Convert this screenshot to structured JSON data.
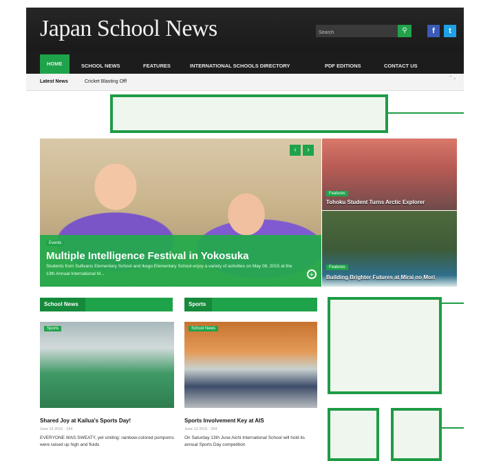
{
  "site": {
    "title": "Japan School News"
  },
  "search": {
    "placeholder": "Search",
    "button_icon": "⚲"
  },
  "social": {
    "facebook": "f",
    "twitter": "t"
  },
  "nav": {
    "items": [
      "HOME",
      "SCHOOL NEWS",
      "FEATURES",
      "INTERNATIONAL SCHOOLS DIRECTORY",
      "PDF EDITIONS",
      "CONTACT US"
    ]
  },
  "ticker": {
    "label": "Latest News",
    "text": "Cricket Blasting Off!",
    "arrows": "⌃⌄"
  },
  "hero": {
    "badge": "Events",
    "title": "Multiple Intelligence Festival in Yokosuka",
    "subtitle": "Students from Sullivans Elementary School and Ikego Elementary School enjoy a variety of activities on May 08, 2015 at the 13th Annual International M...",
    "prev": "‹",
    "next": "›",
    "more": "+"
  },
  "side_stories": [
    {
      "badge": "Features",
      "title": "Tohoku Student Turns Arctic Explorer"
    },
    {
      "badge": "Features",
      "title": "Building Brighter Futures at Mirai no Mori"
    }
  ],
  "sections": [
    {
      "heading": "School News",
      "photo_badge": "Sports",
      "headline": "Shared Joy at Kailua's Sports Day!",
      "meta": "June 14 2015 · 194",
      "excerpt": "EVERYONE WAS SWEATY, yet smiling: rainbow-colored pompoms were raised up high and fluids"
    },
    {
      "heading": "Sports",
      "photo_badge": "School News",
      "headline": "Sports Involvement Key at AIS",
      "meta": "June 13 2015 · 294",
      "excerpt": "On Saturday 13th June Aichi International School will hold its annual Sports Day competition"
    }
  ],
  "colors": {
    "accent": "#1fa34a",
    "callout": "#1e9b45",
    "masthead": "#1f1f1f"
  }
}
